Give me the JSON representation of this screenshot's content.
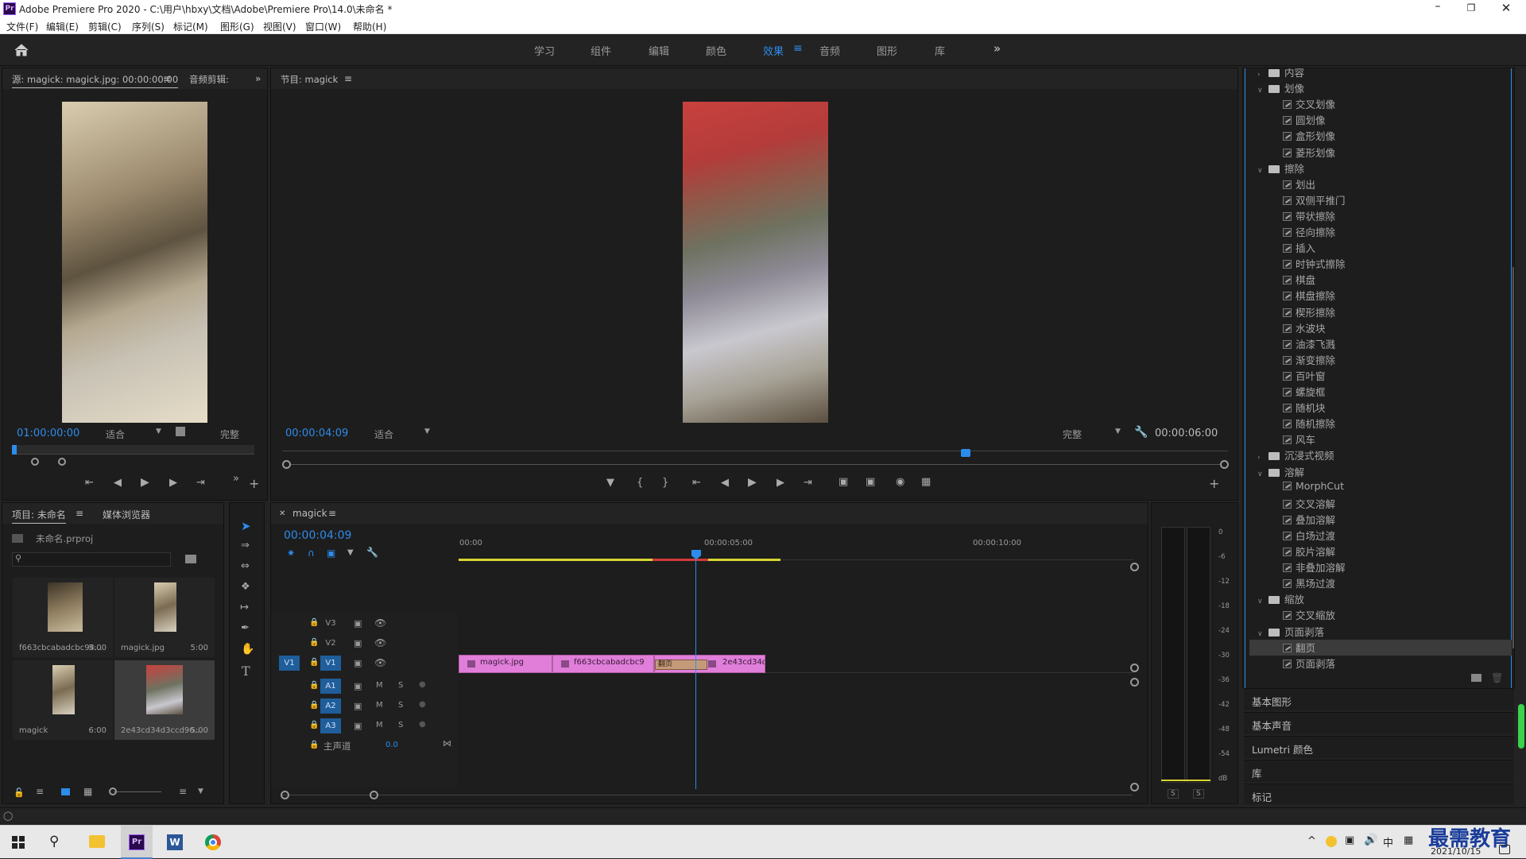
{
  "window": {
    "title": "Adobe Premiere Pro 2020 - C:\\用户\\hbxy\\文档\\Adobe\\Premiere Pro\\14.0\\未命名 *",
    "controls": [
      "minimize",
      "maximize",
      "close"
    ]
  },
  "menu": [
    "文件(F)",
    "编辑(E)",
    "剪辑(C)",
    "序列(S)",
    "标记(M)",
    "图形(G)",
    "视图(V)",
    "窗口(W)",
    "帮助(H)"
  ],
  "workspaces": {
    "tabs": [
      "学习",
      "组件",
      "编辑",
      "颜色",
      "效果",
      "音频",
      "图形",
      "库"
    ],
    "active": "效果",
    "more": "»"
  },
  "source": {
    "tab_label": "源: magick: magick.jpg: 00:00:00:00",
    "tab2_label": "音频剪辑:",
    "timecode": "01:00:00:00",
    "fit": "适合",
    "quality": "完整"
  },
  "program": {
    "tab_label": "节目: magick",
    "timecode": "00:00:04:09",
    "fit": "适合",
    "quality": "完整",
    "duration": "00:00:06:00"
  },
  "project": {
    "tab_label": "项目: 未命名",
    "tab2_label": "媒体浏览器",
    "file": "未命名.prproj",
    "items": [
      {
        "name": "f663cbcabadcbc94...",
        "dur": "5:00"
      },
      {
        "name": "magick.jpg",
        "dur": "5:00"
      },
      {
        "name": "magick",
        "dur": "6:00"
      },
      {
        "name": "2e43cd34d3ccd96...",
        "dur": "5:00"
      }
    ]
  },
  "timeline": {
    "tab_label": "magick",
    "timecode": "00:00:04:09",
    "ruler": [
      "00:00",
      "00:00:05:00",
      "00:00:10:00"
    ],
    "tracks": {
      "video": [
        "V3",
        "V2",
        "V1"
      ],
      "audio": [
        "A1",
        "A2",
        "A3"
      ],
      "master": "主声道",
      "master_value": "0.0",
      "source_patch": "V1"
    },
    "clips": [
      {
        "name": "magick.jpg"
      },
      {
        "name": "f663cbcabadcbc9"
      },
      {
        "name": "翻页"
      },
      {
        "name": "2e43cd34d3cc"
      }
    ]
  },
  "meter": {
    "scale": [
      "0",
      "-6",
      "-12",
      "-18",
      "-24",
      "-30",
      "-36",
      "-42",
      "-48",
      "-54",
      "dB"
    ],
    "solo": [
      "S",
      "S"
    ]
  },
  "effects": {
    "items": [
      {
        "type": "folder",
        "label": "内容",
        "expanded": false
      },
      {
        "type": "folder",
        "label": "划像",
        "expanded": true
      },
      {
        "type": "effect",
        "label": "交叉划像"
      },
      {
        "type": "effect",
        "label": "圆划像"
      },
      {
        "type": "effect",
        "label": "盒形划像"
      },
      {
        "type": "effect",
        "label": "菱形划像"
      },
      {
        "type": "folder",
        "label": "擦除",
        "expanded": true
      },
      {
        "type": "effect",
        "label": "划出"
      },
      {
        "type": "effect",
        "label": "双侧平推门"
      },
      {
        "type": "effect",
        "label": "带状擦除"
      },
      {
        "type": "effect",
        "label": "径向擦除"
      },
      {
        "type": "effect",
        "label": "插入"
      },
      {
        "type": "effect",
        "label": "时钟式擦除"
      },
      {
        "type": "effect",
        "label": "棋盘"
      },
      {
        "type": "effect",
        "label": "棋盘擦除"
      },
      {
        "type": "effect",
        "label": "楔形擦除"
      },
      {
        "type": "effect",
        "label": "水波块"
      },
      {
        "type": "effect",
        "label": "油漆飞溅"
      },
      {
        "type": "effect",
        "label": "渐变擦除"
      },
      {
        "type": "effect",
        "label": "百叶窗"
      },
      {
        "type": "effect",
        "label": "螺旋框"
      },
      {
        "type": "effect",
        "label": "随机块"
      },
      {
        "type": "effect",
        "label": "随机擦除"
      },
      {
        "type": "effect",
        "label": "风车"
      },
      {
        "type": "folder",
        "label": "沉浸式视频",
        "expanded": false
      },
      {
        "type": "folder",
        "label": "溶解",
        "expanded": true
      },
      {
        "type": "effect",
        "label": "MorphCut"
      },
      {
        "type": "effect",
        "label": "交叉溶解"
      },
      {
        "type": "effect",
        "label": "叠加溶解"
      },
      {
        "type": "effect",
        "label": "白场过渡"
      },
      {
        "type": "effect",
        "label": "胶片溶解"
      },
      {
        "type": "effect",
        "label": "非叠加溶解"
      },
      {
        "type": "effect",
        "label": "黑场过渡"
      },
      {
        "type": "folder",
        "label": "缩放",
        "expanded": true
      },
      {
        "type": "effect",
        "label": "交叉缩放"
      },
      {
        "type": "folder",
        "label": "页面剥落",
        "expanded": true
      },
      {
        "type": "effect",
        "label": "翻页",
        "selected": true
      },
      {
        "type": "effect",
        "label": "页面剥落"
      }
    ],
    "sections": [
      "基本图形",
      "基本声音",
      "Lumetri 颜色",
      "库",
      "标记"
    ]
  },
  "taskbar": {
    "tray": [
      "^",
      "中"
    ],
    "date": "2021/10/15",
    "watermark": "最需教育"
  },
  "colors": {
    "accent": "#2d8ceb",
    "clip": "#e07ed9",
    "panel": "#1d1d1d"
  }
}
